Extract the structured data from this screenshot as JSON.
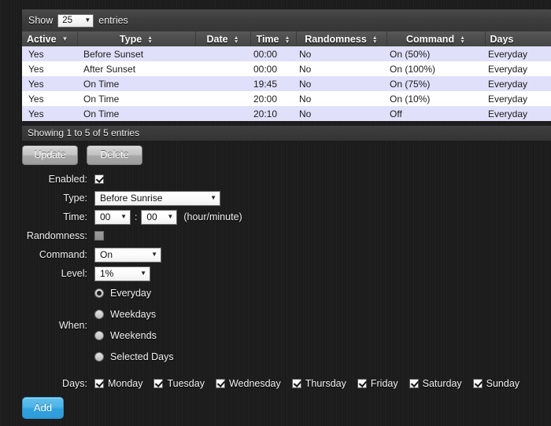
{
  "length_menu": {
    "prefix": "Show",
    "value": "25",
    "suffix": "entries"
  },
  "table": {
    "columns": [
      {
        "label": "Active",
        "sort": "desc"
      },
      {
        "label": "Type",
        "sort": "both"
      },
      {
        "label": "Date",
        "sort": "both"
      },
      {
        "label": "Time",
        "sort": "both"
      },
      {
        "label": "Randomness",
        "sort": "both"
      },
      {
        "label": "Command",
        "sort": "both"
      },
      {
        "label": "Days",
        "sort": "none"
      }
    ],
    "rows": [
      {
        "active": "Yes",
        "type": "Before Sunset",
        "date": "",
        "time": "00:00",
        "randomness": "No",
        "command": "On (50%)",
        "days": "Everyday"
      },
      {
        "active": "Yes",
        "type": "After Sunset",
        "date": "",
        "time": "00:00",
        "randomness": "No",
        "command": "On (100%)",
        "days": "Everyday"
      },
      {
        "active": "Yes",
        "type": "On Time",
        "date": "",
        "time": "19:45",
        "randomness": "No",
        "command": "On (75%)",
        "days": "Everyday"
      },
      {
        "active": "Yes",
        "type": "On Time",
        "date": "",
        "time": "20:00",
        "randomness": "No",
        "command": "On (10%)",
        "days": "Everyday"
      },
      {
        "active": "Yes",
        "type": "On Time",
        "date": "",
        "time": "20:10",
        "randomness": "No",
        "command": "Off",
        "days": "Everyday"
      }
    ],
    "info": "Showing 1 to 5 of 5 entries"
  },
  "actions": {
    "update_label": "Update",
    "delete_label": "Delete"
  },
  "form": {
    "enabled": {
      "label": "Enabled:",
      "checked": true
    },
    "type": {
      "label": "Type:",
      "value": "Before Sunrise"
    },
    "time": {
      "label": "Time:",
      "hour": "00",
      "minute": "00",
      "separator": ":",
      "hint": "(hour/minute)"
    },
    "randomness": {
      "label": "Randomness:",
      "checked": false
    },
    "command": {
      "label": "Command:",
      "value": "On"
    },
    "level": {
      "label": "Level:",
      "value": "1%"
    },
    "when": {
      "label": "When:",
      "options": [
        {
          "label": "Everyday",
          "selected": true
        },
        {
          "label": "Weekdays",
          "selected": false
        },
        {
          "label": "Weekends",
          "selected": false
        },
        {
          "label": "Selected Days",
          "selected": false
        }
      ]
    },
    "days": {
      "label": "Days:",
      "items": [
        {
          "label": "Monday",
          "checked": true
        },
        {
          "label": "Tuesday",
          "checked": true
        },
        {
          "label": "Wednesday",
          "checked": true
        },
        {
          "label": "Thursday",
          "checked": true
        },
        {
          "label": "Friday",
          "checked": true
        },
        {
          "label": "Saturday",
          "checked": true
        },
        {
          "label": "Sunday",
          "checked": true
        }
      ]
    },
    "add_label": "Add"
  },
  "colors": {
    "accent": "#3ea9e0",
    "row_odd": "#e0e0fa",
    "row_even": "#ffffff",
    "background": "#1c1c1c"
  }
}
